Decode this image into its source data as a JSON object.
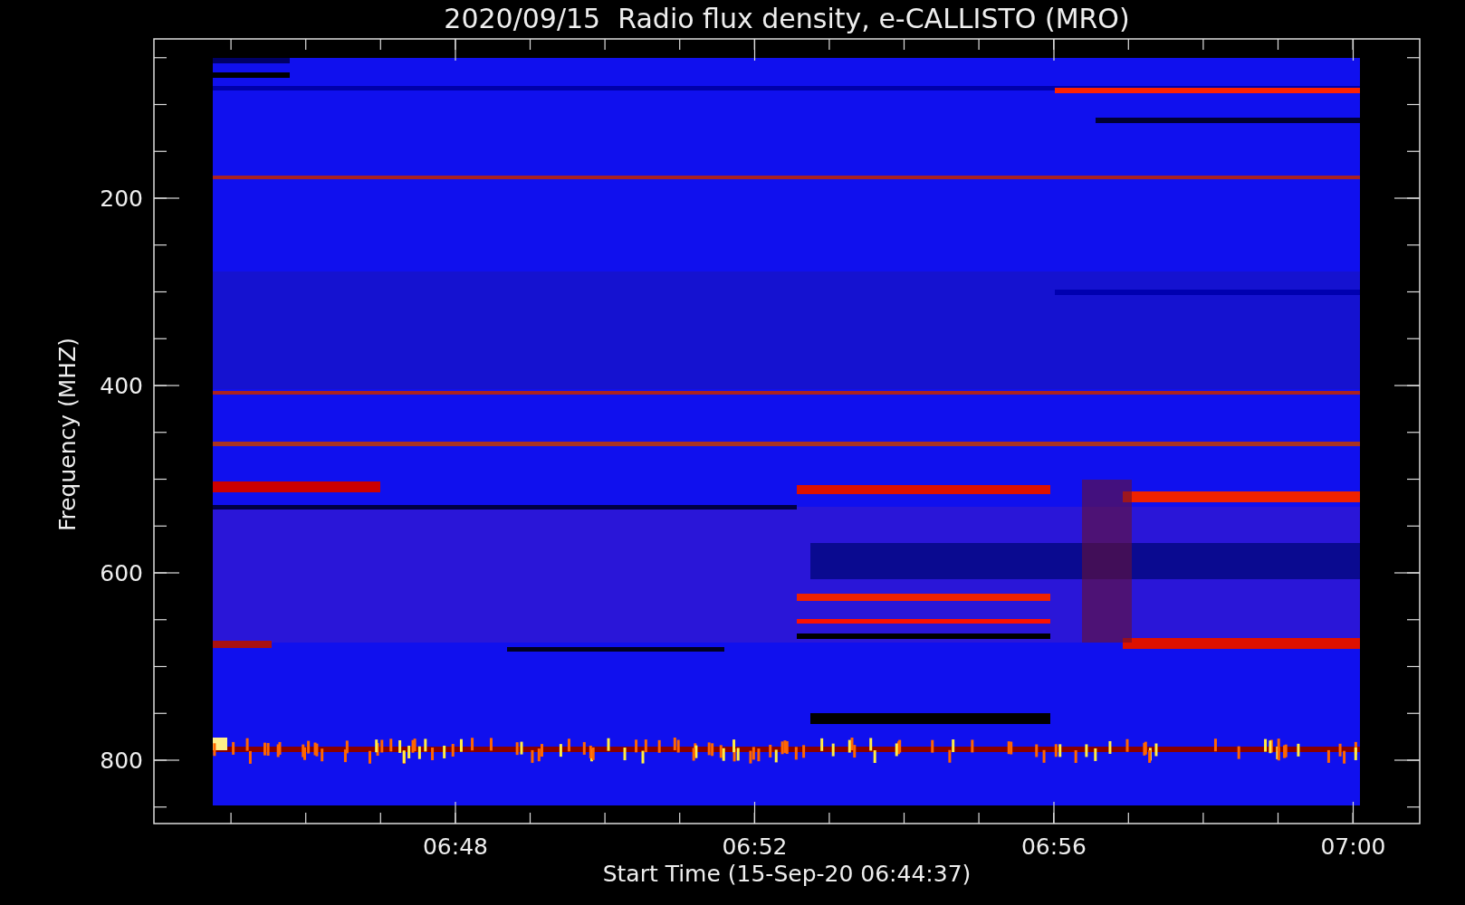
{
  "title": "2020/09/15  Radio flux density, e-CALLISTO (MRO)",
  "y_axis": {
    "label": "Frequency (MHZ)",
    "ticks": [
      "200",
      "400",
      "600",
      "800"
    ]
  },
  "x_axis": {
    "label": "Start Time (15-Sep-20 06:44:37)",
    "ticks": [
      "06:48",
      "06:52",
      "06:56",
      "07:00"
    ]
  }
}
